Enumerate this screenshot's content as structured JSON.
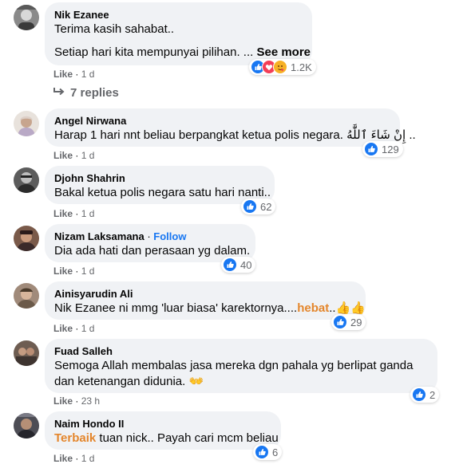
{
  "comments": [
    {
      "author": "Nik Ezanee",
      "lines": [
        "Terima kasih sahabat..",
        "Setiap hari kita mempunyai pilihan. ..."
      ],
      "see_more": "See more",
      "reactions_count": "1.2K",
      "reaction_icons": [
        "like-icon",
        "love-icon",
        "care-icon"
      ],
      "like_label": "Like",
      "time": "1 d",
      "replies_label": "7 replies"
    },
    {
      "author": "Angel Nirwana",
      "text": "Harap 1 hari nnt beliau berpangkat ketua polis negara. إِنْ شَاءَ ٱللَّٰهُ ..",
      "reactions_count": "129",
      "like_label": "Like",
      "time": "1 d"
    },
    {
      "author": "Djohn Shahrin",
      "text": "Bakal ketua polis negara satu hari nanti..",
      "reactions_count": "62",
      "like_label": "Like",
      "time": "1 d"
    },
    {
      "author": "Nizam Laksamana",
      "follow_label": "Follow",
      "text": "Dia ada hati dan perasaan yg dalam.",
      "reactions_count": "40",
      "like_label": "Like",
      "time": "1 d"
    },
    {
      "author": "Ainisyarudin Ali",
      "text_before": "Nik Ezanee ni mmg 'luar biasa' karektornya....",
      "highlight": "hebat",
      "text_after": "..👍👍",
      "reactions_count": "29",
      "like_label": "Like",
      "time": "1 d"
    },
    {
      "author": "Fuad Salleh",
      "text": "Semoga Allah membalas jasa mereka dgn pahala yg berlipat ganda dan ketenangan didunia. 👐",
      "reactions_count": "2",
      "like_label": "Like",
      "time": "23 h"
    },
    {
      "author": "Naim Hondo II",
      "highlight": "Terbaik",
      "text_after": " tuan nick.. Payah cari mcm beliau",
      "reactions_count": "6",
      "like_label": "Like",
      "time": "1 d"
    }
  ],
  "colors": {
    "bubble": "#f0f2f5",
    "like_blue": "#1877f2",
    "meta_gray": "#65676b",
    "highlight_orange": "#e4862c"
  }
}
